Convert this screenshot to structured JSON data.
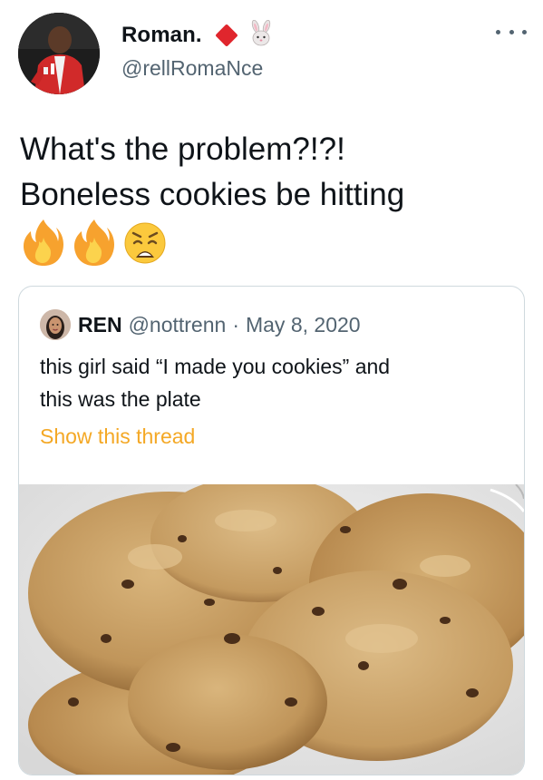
{
  "tweet": {
    "display_name": "Roman.",
    "handle": "@rellRomaNce",
    "text_lines": [
      "What's the problem?!?!",
      "Boneless cookies be hitting"
    ],
    "emojis": [
      "fire-emoji",
      "fire-emoji",
      "weary-face-emoji"
    ],
    "more_icon": "more-horizontal-icon",
    "name_icons": [
      "red-diamond-icon",
      "rabbit-face-icon"
    ]
  },
  "quote": {
    "display_name": "REN",
    "handle": "@nottrenn",
    "separator": "·",
    "date": "May 8, 2020",
    "text_lines": [
      "this girl said “I made you cookies” and",
      "this was the plate"
    ],
    "show_thread": "Show this thread"
  },
  "colors": {
    "text_primary": "#0f1419",
    "text_secondary": "#536471",
    "show_thread_link": "#f4a825",
    "diamond": "#e0262d",
    "card_border": "#cfd9de"
  }
}
